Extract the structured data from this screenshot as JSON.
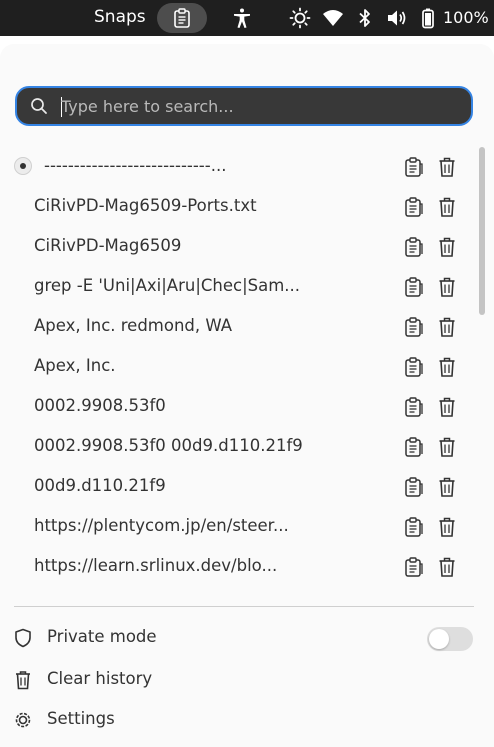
{
  "topbar": {
    "app_name": "Snaps",
    "battery_percent": "100%",
    "icons": [
      "clipboard-icon",
      "accessibility-icon",
      "brightness-icon",
      "wifi-icon",
      "bluetooth-icon",
      "volume-icon",
      "battery-icon"
    ]
  },
  "search": {
    "placeholder": "Type here to search...",
    "value": ""
  },
  "history": {
    "items": [
      {
        "text": "----------------------------...",
        "active": true
      },
      {
        "text": "CiRivPD-Mag6509-Ports.txt"
      },
      {
        "text": "CiRivPD-Mag6509"
      },
      {
        "text": "grep -E 'Uni|Axi|Aru|Chec|Sam..."
      },
      {
        "text": "Apex, Inc. redmond, WA"
      },
      {
        "text": "Apex, Inc."
      },
      {
        "text": "0002.9908.53f0"
      },
      {
        "text": "0002.9908.53f0 00d9.d110.21f9"
      },
      {
        "text": "00d9.d110.21f9"
      },
      {
        "text": "https://plentycom.jp/en/steer..."
      },
      {
        "text": "https://learn.srlinux.dev/blo..."
      }
    ]
  },
  "menu": {
    "private_mode": "Private mode",
    "private_mode_enabled": false,
    "clear_history": "Clear history",
    "settings": "Settings"
  },
  "colors": {
    "topbar_bg": "#1f1f1f",
    "search_border": "#3584e4",
    "search_bg": "#383838",
    "popup_bg": "#fafafa"
  }
}
